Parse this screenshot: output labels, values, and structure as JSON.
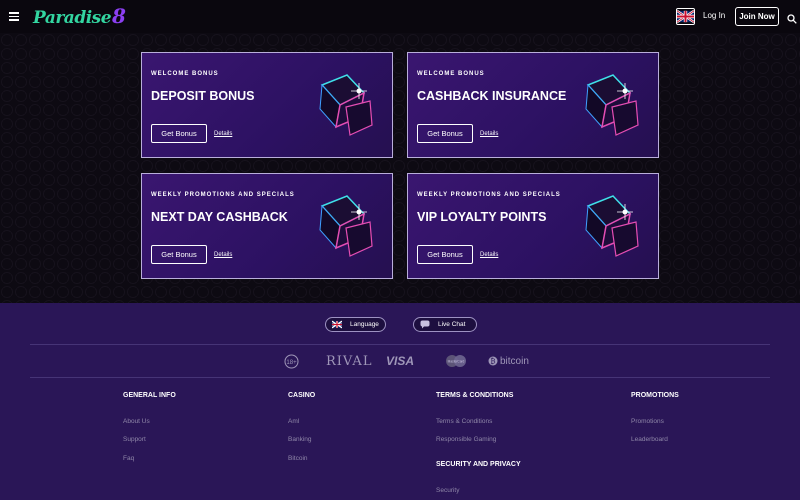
{
  "header": {
    "logo_text": "Paradise",
    "logo_number": "8",
    "login_label": "Log In",
    "join_label": "Join Now"
  },
  "cards": [
    {
      "eyebrow": "WELCOME BONUS",
      "title": "DEPOSIT BONUS",
      "button": "Get Bonus",
      "details": "Details"
    },
    {
      "eyebrow": "WELCOME BONUS",
      "title": "CASHBACK INSURANCE",
      "button": "Get Bonus",
      "details": "Details"
    },
    {
      "eyebrow": "WEEKLY PROMOTIONS AND SPECIALS",
      "title": "NEXT DAY CASHBACK",
      "button": "Get Bonus",
      "details": "Details"
    },
    {
      "eyebrow": "WEEKLY PROMOTIONS AND SPECIALS",
      "title": "VIP LOYALTY POINTS",
      "button": "Get Bonus",
      "details": "Details"
    }
  ],
  "footer": {
    "language_label": "Language",
    "livechat_label": "Live Chat",
    "payments": {
      "age": "18+",
      "rival": "RIVAL",
      "visa": "VISA",
      "mastercard": "MasterCard",
      "bitcoin": "bitcoin"
    },
    "general": {
      "heading": "GENERAL INFO",
      "links": [
        "About Us",
        "Support",
        "Faq"
      ]
    },
    "casino": {
      "heading": "CASINO",
      "links": [
        "Aml",
        "Banking",
        "Bitcoin"
      ]
    },
    "terms": {
      "heading": "TERMS & CONDITIONS",
      "links": [
        "Terms & Conditions",
        "Responsible Gaming"
      ]
    },
    "security": {
      "heading": "SECURITY AND PRIVACY",
      "links": [
        "Security"
      ]
    },
    "promotions": {
      "heading": "PROMOTIONS",
      "links": [
        "Promotions",
        "Leaderboard"
      ]
    }
  },
  "colors": {
    "accent_green": "#33d6a1",
    "accent_purple": "#8b3ff0",
    "card_bg": "#2c1162",
    "footer_bg": "#2a1657"
  }
}
